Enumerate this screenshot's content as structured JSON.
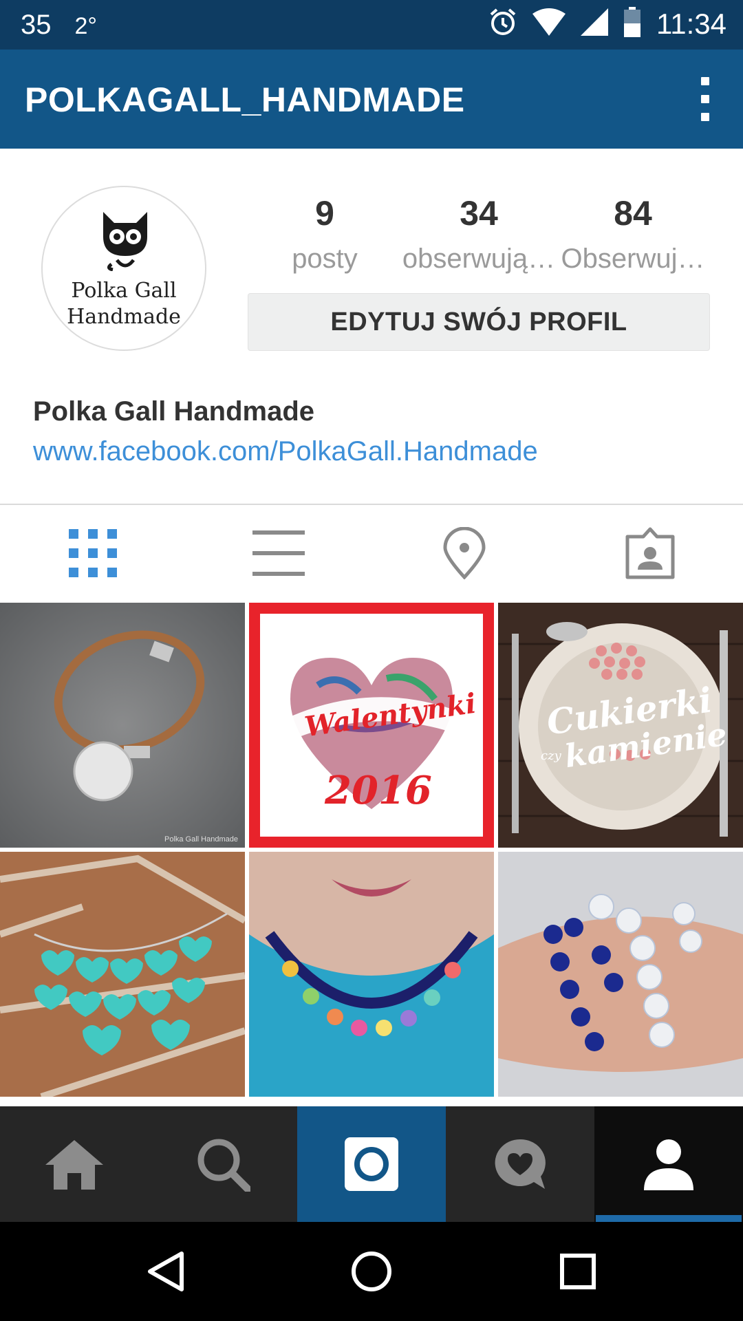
{
  "status_bar": {
    "notification_count": "35",
    "temperature": "2°",
    "time": "11:34",
    "icons": [
      "alarm-icon",
      "wifi-icon",
      "signal-icon",
      "battery-icon"
    ]
  },
  "app_bar": {
    "title": "POLKAGALL_HANDMADE",
    "menu_icon": "overflow-menu-icon"
  },
  "profile": {
    "avatar_text_line1": "Polka Gall",
    "avatar_text_line2": "Handmade",
    "stats": [
      {
        "value": "9",
        "label": "posty"
      },
      {
        "value": "34",
        "label": "obserwują…"
      },
      {
        "value": "84",
        "label": "Obserwuj…"
      }
    ],
    "edit_button_label": "EDYTUJ SWÓJ PROFIL",
    "name": "Polka Gall Handmade",
    "link": "www.facebook.com/PolkaGall.Handmade"
  },
  "view_tabs": [
    {
      "name": "grid-view-icon",
      "active": true
    },
    {
      "name": "list-view-icon",
      "active": false
    },
    {
      "name": "map-pin-icon",
      "active": false
    },
    {
      "name": "tagged-photos-icon",
      "active": false
    }
  ],
  "grid": {
    "tiles": [
      {
        "subject": "leather bracelet with round charm",
        "watermark": "Polka Gall Handmade"
      },
      {
        "subject": "heart collage",
        "caption": "Walentynki",
        "year": "2016"
      },
      {
        "subject": "plate with candy hearts",
        "caption_line1": "Cukierki",
        "caption_small": "czy",
        "caption_line2": "kamienie"
      },
      {
        "subject": "turquoise heart necklace"
      },
      {
        "subject": "colorful teddy bead necklace"
      },
      {
        "subject": "blue and opal bead bracelets"
      }
    ]
  },
  "bottom_nav": [
    {
      "name": "home-icon",
      "active": false
    },
    {
      "name": "search-icon",
      "active": false
    },
    {
      "name": "camera-icon",
      "active": false
    },
    {
      "name": "activity-heart-icon",
      "active": false
    },
    {
      "name": "profile-icon",
      "active": true
    }
  ],
  "system_nav": [
    "back-icon",
    "home-circle-icon",
    "recents-icon"
  ],
  "colors": {
    "status_bar": "#0e3c62",
    "app_bar": "#125688",
    "accent_blue": "#3d8fd8",
    "nav_bg": "#262626"
  }
}
